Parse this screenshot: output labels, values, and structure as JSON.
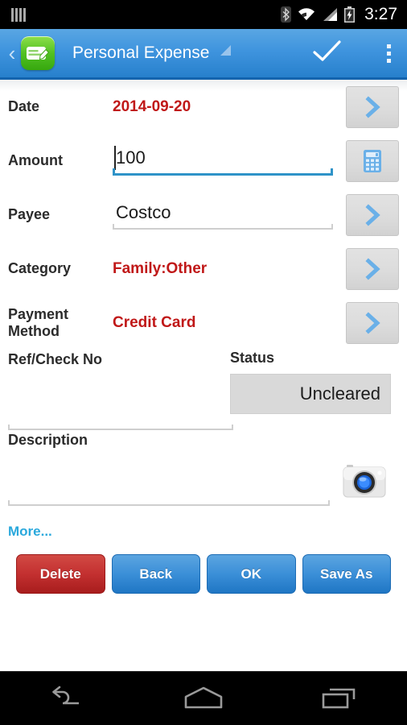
{
  "status_bar": {
    "sim_icon": "sim-signal-icon",
    "bluetooth_icon": "bluetooth-icon",
    "wifi_icon": "wifi-icon",
    "cellular_icon": "cellular-signal-icon",
    "battery_icon": "battery-charging-icon",
    "time": "3:27"
  },
  "action_bar": {
    "back_chevron": "‹",
    "app_icon": "checkbook-edit-icon",
    "title": "Personal Expense",
    "spinner_icon": "dropdown-triangle-icon",
    "confirm_icon": "checkmark-icon",
    "overflow_icon": "overflow-menu-icon",
    "accent": "#2780cc"
  },
  "form": {
    "rows": [
      {
        "label": "Date",
        "value": "2014-09-20",
        "value_color": "#c01818",
        "action_icon": "chevron-right-icon"
      },
      {
        "label": "Amount",
        "value": "100",
        "action_icon": "calculator-icon"
      },
      {
        "label": "Payee",
        "value": "Costco",
        "action_icon": "chevron-right-icon"
      },
      {
        "label": "Category",
        "value": "Family:Other",
        "value_color": "#c01818",
        "action_icon": "chevron-right-icon"
      },
      {
        "label": "Payment Method",
        "value": "Credit Card",
        "value_color": "#c01818",
        "action_icon": "chevron-right-icon"
      }
    ],
    "ref_label": "Ref/Check No",
    "ref_value": "",
    "status_label": "Status",
    "status_value": "Uncleared",
    "description_label": "Description",
    "description_value": "",
    "camera_icon": "camera-icon",
    "more_label": "More..."
  },
  "buttons": [
    {
      "label": "Delete",
      "style": "red"
    },
    {
      "label": "Back",
      "style": "blue"
    },
    {
      "label": "OK",
      "style": "blue"
    },
    {
      "label": "Save As",
      "style": "blue"
    }
  ],
  "nav_bar": {
    "back_icon": "nav-back-icon",
    "home_icon": "nav-home-icon",
    "recents_icon": "nav-recents-icon"
  }
}
